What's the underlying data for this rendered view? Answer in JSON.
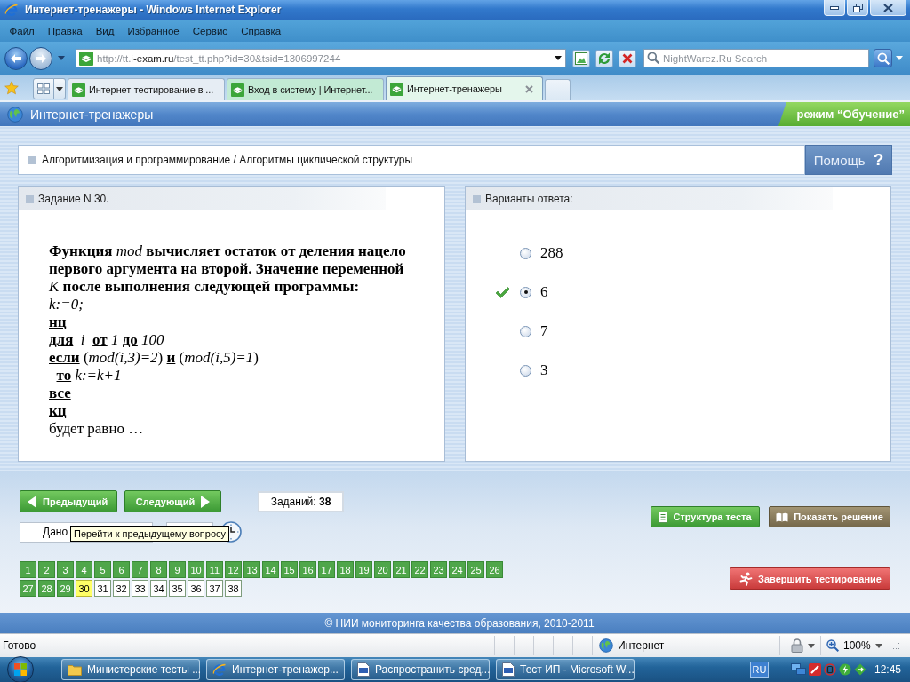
{
  "window": {
    "title": "Интернет-тренажеры - Windows Internet Explorer"
  },
  "menu": [
    "Файл",
    "Правка",
    "Вид",
    "Избранное",
    "Сервис",
    "Справка"
  ],
  "address_bar": {
    "url": {
      "host_prefix": "http://tt.",
      "domain": "i-exam.ru",
      "path": "/test_tt.php?id=30&tsid=1306997244"
    },
    "search": {
      "placeholder": "NightWarez.Ru Search"
    }
  },
  "tabs": [
    {
      "label": "Интернет-тестирование в ...",
      "selected": false,
      "color": "#e6edf4"
    },
    {
      "label": "Вход в систему | Интернет...",
      "selected": false,
      "color": "#c2ead4"
    },
    {
      "label": "Интернет-тренажеры",
      "selected": true,
      "color": "#e4f6ec"
    }
  ],
  "page": {
    "header": {
      "title": "Интернет-тренажеры",
      "mode": "режим “Обучение”"
    },
    "breadcrumb": "Алгоритмизация и программирование / Алгоритмы циклической структуры",
    "help_button": {
      "label": "Помощь",
      "icon_text": "?"
    },
    "task": {
      "heading": "Задание N 30.",
      "statement": "Функция *mod* вычисляет остаток от деления нацело первого аргумента на второй. Значение переменной *K* после выполнения следующей программы:",
      "code": [
        "*k:=0;*",
        "**нц**",
        "**для**  *i*  **от** *1* **до** *100*",
        "**если** (*mod(i,3)=2*) **и** (*mod(i,5)=1*)",
        "  **то** *k:=k+1*",
        "**все**",
        "**кц**"
      ],
      "ending": "будет равно …"
    },
    "answers": {
      "heading": "Варианты ответа:",
      "options": [
        {
          "value": "288",
          "selected": false,
          "correct": false
        },
        {
          "value": "6",
          "selected": true,
          "correct": true
        },
        {
          "value": "7",
          "selected": false,
          "correct": false
        },
        {
          "value": "3",
          "selected": false,
          "correct": false
        }
      ]
    },
    "navigation": {
      "prev": "Предыдущий",
      "next": "Следующий",
      "count": "Заданий: **38**"
    },
    "progress_field": {
      "value": "Дано"
    },
    "tooltip": "Перейти к предыдущему вопросу",
    "question_numbers": [
      {
        "label": "1",
        "answered": true,
        "selected": false
      },
      {
        "label": "2",
        "answered": true,
        "selected": false
      },
      {
        "label": "3",
        "answered": true,
        "selected": false
      },
      {
        "label": "4",
        "answered": true,
        "selected": false
      },
      {
        "label": "5",
        "answered": true,
        "selected": false
      },
      {
        "label": "6",
        "answered": true,
        "selected": false
      },
      {
        "label": "7",
        "answered": true,
        "selected": false
      },
      {
        "label": "8",
        "answered": true,
        "selected": false
      },
      {
        "label": "9",
        "answered": true,
        "selected": false
      },
      {
        "label": "10",
        "answered": true,
        "selected": false
      },
      {
        "label": "11",
        "answered": true,
        "selected": false
      },
      {
        "label": "12",
        "answered": true,
        "selected": false
      },
      {
        "label": "13",
        "answered": true,
        "selected": false
      },
      {
        "label": "14",
        "answered": true,
        "selected": false
      },
      {
        "label": "15",
        "answered": true,
        "selected": false
      },
      {
        "label": "16",
        "answered": true,
        "selected": false
      },
      {
        "label": "17",
        "answered": true,
        "selected": false
      },
      {
        "label": "18",
        "answered": true,
        "selected": false
      },
      {
        "label": "19",
        "answered": true,
        "selected": false
      },
      {
        "label": "20",
        "answered": true,
        "selected": false
      },
      {
        "label": "21",
        "answered": true,
        "selected": false
      },
      {
        "label": "22",
        "answered": true,
        "selected": false
      },
      {
        "label": "23",
        "answered": true,
        "selected": false
      },
      {
        "label": "24",
        "answered": true,
        "selected": false
      },
      {
        "label": "25",
        "answered": true,
        "selected": false
      },
      {
        "label": "26",
        "answered": true,
        "selected": false
      },
      {
        "label": "27",
        "answered": true,
        "selected": false
      },
      {
        "label": "28",
        "answered": true,
        "selected": false
      },
      {
        "label": "29",
        "answered": true,
        "selected": false
      },
      {
        "label": "30",
        "answered": false,
        "selected": true
      },
      {
        "label": "31",
        "answered": false,
        "selected": false
      },
      {
        "label": "32",
        "answered": false,
        "selected": false
      },
      {
        "label": "33",
        "answered": false,
        "selected": false
      },
      {
        "label": "34",
        "answered": false,
        "selected": false
      },
      {
        "label": "35",
        "answered": false,
        "selected": false
      },
      {
        "label": "36",
        "answered": false,
        "selected": false
      },
      {
        "label": "37",
        "answered": false,
        "selected": false
      },
      {
        "label": "38",
        "answered": false,
        "selected": false
      }
    ],
    "actions": [
      {
        "label": "Структура теста",
        "kind": "structure"
      },
      {
        "label": "Показать решение",
        "kind": "solution"
      }
    ],
    "finish_button": "Завершить тестирование",
    "footer": "© НИИ мониторинга качества образования, 2010-2011"
  },
  "status_bar": {
    "text": "Готово",
    "zone": "Интернет",
    "zoom": "100%"
  },
  "taskbar": {
    "tasks": [
      {
        "label": "Министерские тесты ...",
        "kind": "folder"
      },
      {
        "label": "Интернет-тренажер...",
        "kind": "browser"
      },
      {
        "label": "Распространить сред...",
        "kind": "document"
      },
      {
        "label": "Тест ИП - Microsoft W...",
        "kind": "document"
      }
    ],
    "language": "RU",
    "clock": "12:45"
  }
}
